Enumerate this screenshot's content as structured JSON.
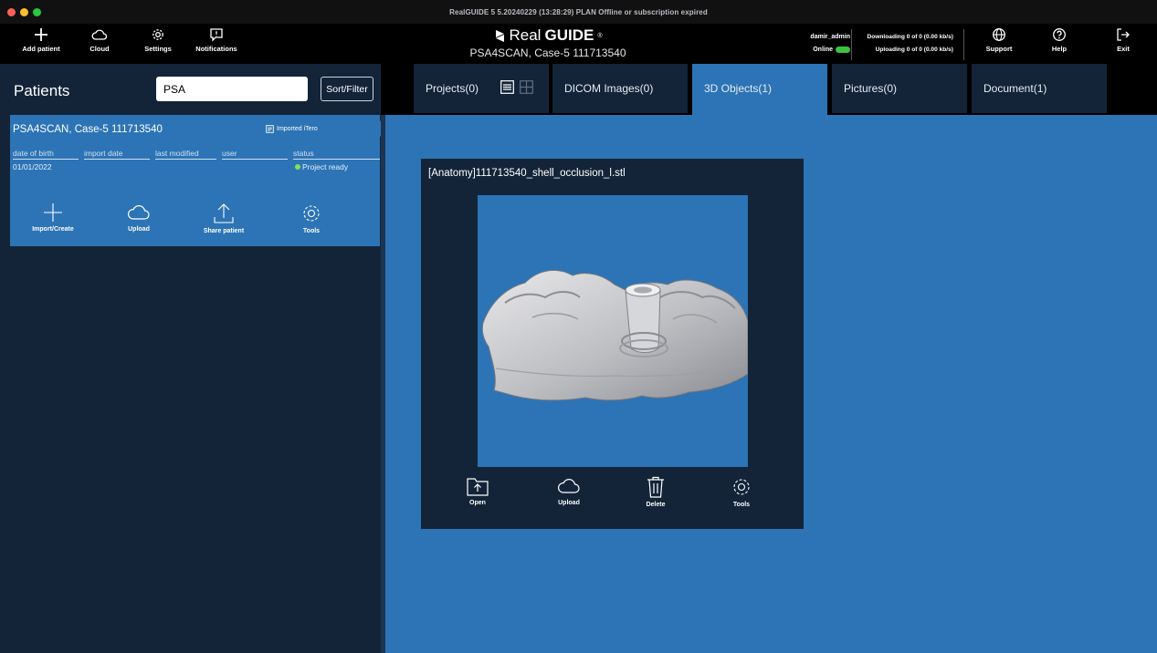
{
  "window": {
    "title": "RealGUIDE 5  5.20240229 (13:28:29)  PLAN Offline or subscription expired"
  },
  "toolbar": {
    "add_patient": "Add patient",
    "cloud": "Cloud",
    "settings": "Settings",
    "notifications": "Notifications",
    "brand_light": "Real",
    "brand_bold": "GUIDE",
    "case_title": "PSA4SCAN, Case-5 111713540",
    "username": "damir_admin",
    "online_label": "Online",
    "downloading": "Downloading 0 of 0 (0.00 kb/s)",
    "uploading": "Uploading 0 of 0 (0.00 kb/s)",
    "support": "Support",
    "help": "Help",
    "exit": "Exit"
  },
  "patients": {
    "title": "Patients",
    "search_value": "PSA",
    "sort_filter": "Sort/Filter",
    "card": {
      "name": "PSA4SCAN, Case-5  111713540",
      "imported": "Imported iTero",
      "columns": {
        "dob": "date of birth",
        "import_date": "import date",
        "last_modified": "last modified",
        "user": "user",
        "status": "status"
      },
      "values": {
        "dob": "01/01/2022",
        "status": "Project ready"
      },
      "actions": {
        "import_create": "Import/Create",
        "upload": "Upload",
        "share": "Share patient",
        "tools": "Tools"
      }
    }
  },
  "tabs": {
    "projects": "Projects(0)",
    "dicom": "DICOM Images(0)",
    "objects": "3D Objects(1)",
    "pictures": "Pictures(0)",
    "document": "Document(1)"
  },
  "object": {
    "title": "[Anatomy]111713540_shell_occlusion_l.stl",
    "actions": {
      "open": "Open",
      "upload": "Upload",
      "delete": "Delete",
      "tools": "Tools"
    }
  },
  "colors": {
    "accent_blue": "#2c74b5",
    "panel_navy": "#132438",
    "status_green": "#7de35a"
  }
}
